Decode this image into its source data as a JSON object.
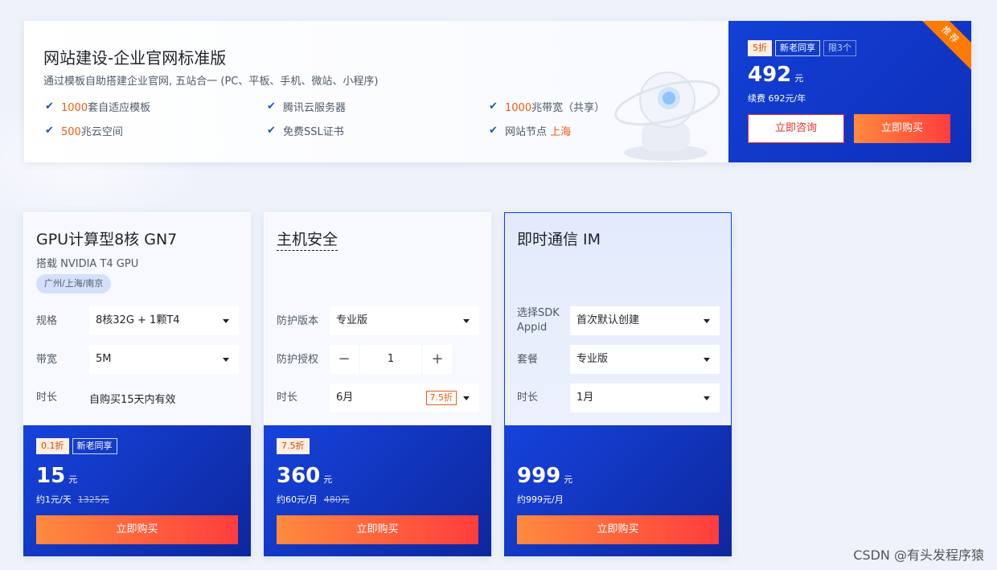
{
  "banner": {
    "title": "网站建设-企业官网标准版",
    "subtitle": "通过模板自助搭建企业官网, 五站合一 (PC、平板、手机、微站、小程序)",
    "features": [
      {
        "hl": "1000",
        "text": "套自适应模板"
      },
      {
        "hl": "",
        "text": "腾讯云服务器"
      },
      {
        "hl": "1000",
        "text": "兆带宽（共享）"
      },
      {
        "hl": "500",
        "text": "兆云空间"
      },
      {
        "hl": "",
        "text": "免费SSL证书"
      },
      {
        "hl": "上海",
        "text": "网站节点 "
      }
    ],
    "ribbon": "推荐",
    "tags": [
      "5折",
      "新老同享",
      "限3个"
    ],
    "price": "492",
    "unit": "元",
    "renew": "续费 692元/年",
    "consult_label": "立即咨询",
    "buy_label": "立即购买"
  },
  "cards": [
    {
      "title": "GPU计算型8核 GN7",
      "subtitle": "搭载 NVIDIA T4 GPU",
      "region": "广州/上海/南京",
      "rows": [
        {
          "label": "规格",
          "value": "8核32G + 1颗T4"
        },
        {
          "label": "带宽",
          "value": "5M"
        },
        {
          "label": "时长",
          "value": "自购买15天内有效"
        }
      ],
      "tags": [
        "0.1折",
        "新老同享"
      ],
      "price": "15",
      "unit": "元",
      "per": "约1元/天",
      "orig": "1325元",
      "buy_label": "立即购买"
    },
    {
      "title": "主机安全",
      "rows": [
        {
          "label": "防护版本",
          "value": "专业版"
        },
        {
          "label": "防护授权",
          "value": "1"
        },
        {
          "label": "时长",
          "value": "6月",
          "badge": "7.5折"
        }
      ],
      "tags": [
        "7.5折"
      ],
      "price": "360",
      "unit": "元",
      "per": "约60元/月",
      "orig": "480元",
      "buy_label": "立即购买"
    },
    {
      "title": "即时通信 IM",
      "rows": [
        {
          "label": "选择SDK Appid",
          "value": "首次默认创建"
        },
        {
          "label": "套餐",
          "value": "专业版"
        },
        {
          "label": "时长",
          "value": "1月"
        }
      ],
      "price": "999",
      "unit": "元",
      "per": "约999元/月",
      "buy_label": "立即购买"
    }
  ],
  "watermark": "CSDN @有头发程序猿",
  "colors": {
    "accent": "#1240d6",
    "highlight": "#f35a12",
    "buy": "#ff3d3d"
  }
}
